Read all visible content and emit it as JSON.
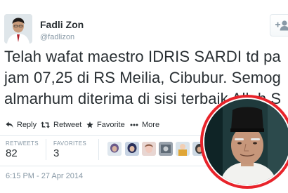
{
  "author": {
    "name": "Fadli Zon",
    "handle": "@fadlizon"
  },
  "tweet": {
    "lines": [
      "Telah wafat maestro IDRIS SARDI td pa",
      "jam 07,25 di RS Meilia, Cibubur. Semog",
      "almarhum diterima di sisi terbaik Allah S"
    ]
  },
  "actions": {
    "reply": "Reply",
    "retweet": "Retweet",
    "favorite": "Favorite",
    "more": "More"
  },
  "stats": {
    "retweets_label": "RETWEETS",
    "retweets_value": "82",
    "favorites_label": "FAVORITES",
    "favorites_value": "3"
  },
  "timestamp": "6:15 PM - 27 Apr 2014",
  "colors": {
    "link": "#8899a6",
    "text": "#292f33",
    "inset_ring": "#e8232a"
  },
  "icons": [
    "reply-icon",
    "retweet-icon",
    "favorite-star-icon",
    "more-dots-icon",
    "follow-user-plus-icon"
  ]
}
